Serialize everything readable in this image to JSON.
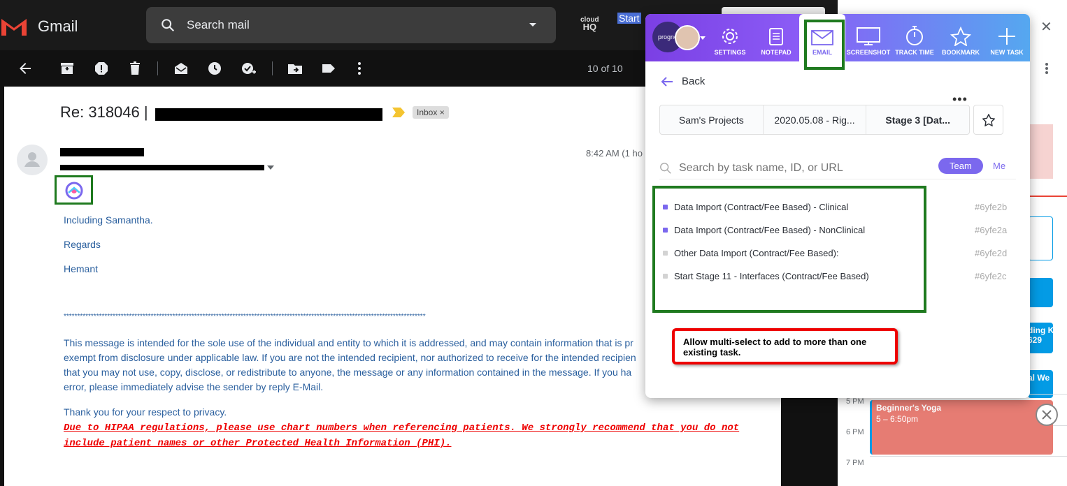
{
  "gmail": {
    "logo_text": "Gmail",
    "search_placeholder": "Search mail",
    "counter": "10 of 10",
    "selected_text": "Start"
  },
  "email": {
    "subject": "Re: 318046 |",
    "inbox_label": "Inbox ×",
    "time": "8:42 AM (1 ho",
    "lines": [
      "Including Samantha.",
      "Regards",
      "Hemant"
    ],
    "stars": "*************************************************************************************************************************************",
    "disclaimer": "This message is intended for the sole use of the individual and entity to which it is addressed, and may contain information that is pr exempt from disclosure under applicable law. If you are not the intended recipient, nor authorized to receive for the intended recipien that you may not use, copy, disclose, or redistribute to anyone, the message or any information contained in the message.  If you ha error, please immediately advise the sender by reply E-Mail.",
    "thanks": "Thank you for your respect to privacy.",
    "hipaa": "Due to HIPAA regulations, please use chart numbers when referencing patients.  We strongly recommend that you do not include patient names or other Protected Health Information (PHI)."
  },
  "calendar": {
    "hours": [
      "5 PM",
      "6 PM",
      "7 PM"
    ],
    "events": [
      {
        "title": "Beginner's Yoga",
        "time": "5 – 6:50pm",
        "color": "#e67c73"
      },
      {
        "title": "ding K",
        "time": "629",
        "color": "#039be5"
      },
      {
        "title": "al We",
        "time": "",
        "color": "#039be5"
      }
    ]
  },
  "popup": {
    "logo_text": "progno",
    "nav": [
      {
        "label": "SETTINGS",
        "icon": "gear-icon"
      },
      {
        "label": "NOTEPAD",
        "icon": "notepad-icon"
      },
      {
        "label": "EMAIL",
        "icon": "envelope-icon"
      },
      {
        "label": "SCREENSHOT",
        "icon": "monitor-icon"
      },
      {
        "label": "TRACK TIME",
        "icon": "stopwatch-icon"
      },
      {
        "label": "BOOKMARK",
        "icon": "star-icon"
      },
      {
        "label": "NEW TASK",
        "icon": "plus-icon"
      }
    ],
    "back_label": "Back",
    "breadcrumb": [
      "Sam's Projects",
      "2020.05.08 - Rig...",
      "Stage 3 [Dat..."
    ],
    "search_placeholder": "Search by task name, ID, or URL",
    "filter_team": "Team",
    "filter_me": "Me",
    "tasks": [
      {
        "name": "Data Import (Contract/Fee Based) - Clinical",
        "id": "#6yfe2b",
        "color": "#7b68ee"
      },
      {
        "name": "Data Import (Contract/Fee Based) - NonClinical",
        "id": "#6yfe2a",
        "color": "#7b68ee"
      },
      {
        "name": "Other Data Import (Contract/Fee Based):",
        "id": "#6yfe2d",
        "color": "#d3d3d3"
      },
      {
        "name": "Start Stage 11 - Interfaces (Contract/Fee Based)",
        "id": "#6yfe2c",
        "color": "#d3d3d3"
      }
    ],
    "annotation": "Allow multi-select to add to more than one existing task."
  }
}
